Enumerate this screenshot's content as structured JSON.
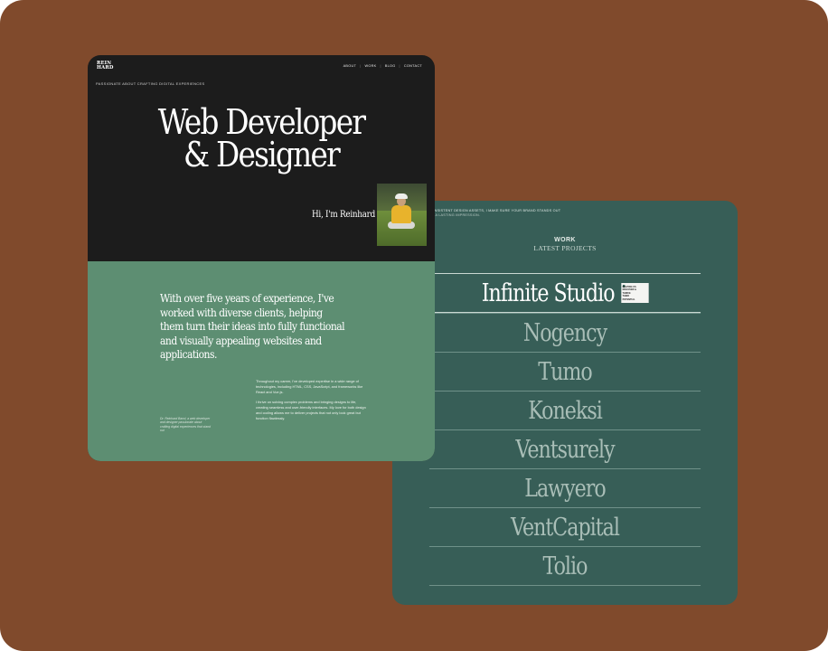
{
  "work_card": {
    "intro_line1": "AND IDENTITY, AND CONSISTENT DESIGN ASSETS, I MAKE SURE YOUR BRAND STANDS OUT",
    "intro_line2": "AUDIENCE, INCLUDING A LASTING IMPRESSION.",
    "heading": "WORK",
    "subheading": "LATEST PROJECTS",
    "projects": [
      {
        "name": "Infinite Studio",
        "active": true,
        "thumb_text": "HELPING US DISCOVER & THRIVE THEIR POTENTIAL"
      },
      {
        "name": "Nogency"
      },
      {
        "name": "Tumo"
      },
      {
        "name": "Koneksi"
      },
      {
        "name": "Ventsurely"
      },
      {
        "name": "Lawyero"
      },
      {
        "name": "VentCapital"
      },
      {
        "name": "Tolio"
      }
    ]
  },
  "hero_card": {
    "logo_line1": "REIN",
    "logo_line2": "HARD",
    "nav": [
      "ABOUT",
      "WORK",
      "BLOG",
      "CONTACT"
    ],
    "tagline": "PASSIONATE ABOUT CRAFTING DIGITAL EXPERIENCES",
    "title_line1": "Web Developer",
    "title_line2": "& Designer",
    "greeting": "Hi, I'm Reinhard",
    "intro": "With over five years of experience, I've worked with diverse clients, helping them turn their ideas into fully functional and visually appealing websites and applications.",
    "paragraph1": "Throughout my career, I've developed expertise in a wide range of technologies, including HTML, CSS, JavaScript, and frameworks like React and Vue.js.",
    "paragraph2": "I thrive on solving complex problems and bringing designs to life, creating seamless and user-friendly interfaces. My love for both design and coding allows me to deliver projects that not only look great but function flawlessly.",
    "side_note": "Dr. Reinhard Barrd, a web developer and designer passionate about crafting digital experiences that stand out"
  },
  "colors": {
    "background": "#804a2c",
    "hero_dark": "#1c1c1c",
    "hero_green": "#5d8e72",
    "work_green": "#375e57"
  }
}
